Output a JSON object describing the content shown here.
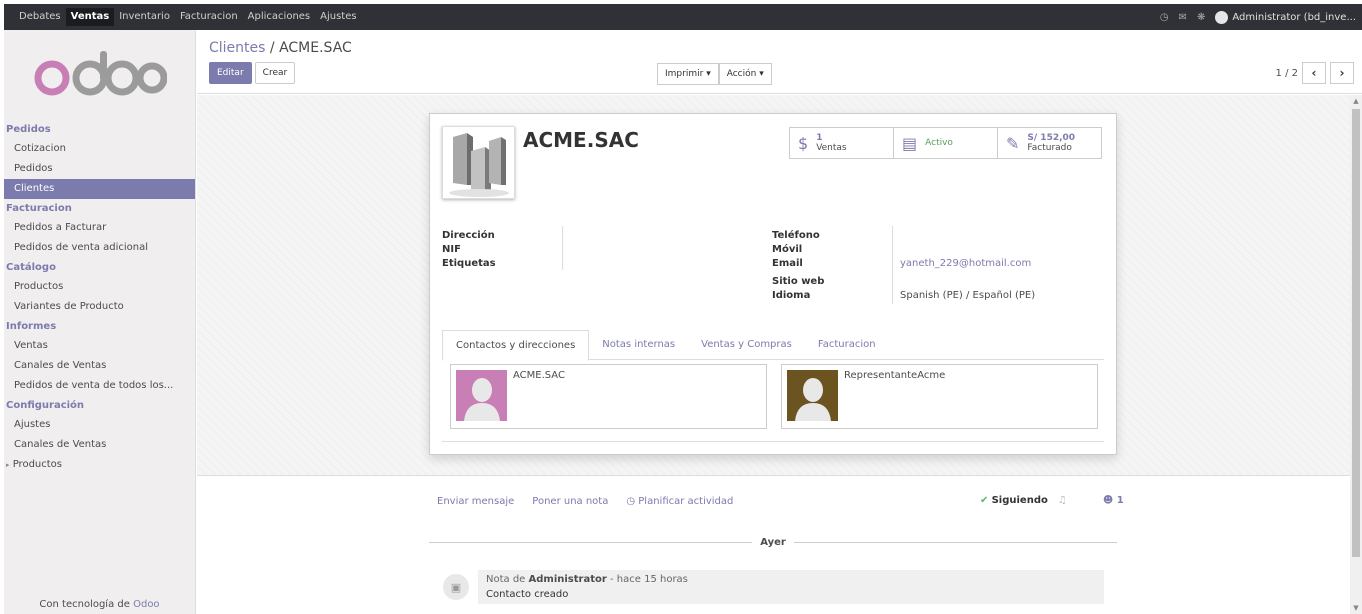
{
  "topbar": {
    "menu": [
      "Debates",
      "Ventas",
      "Inventario",
      "Facturacion",
      "Aplicaciones",
      "Ajustes"
    ],
    "active": "Ventas",
    "user": "Administrator (bd_inve..."
  },
  "sidebar": {
    "sections": [
      {
        "title": "Pedidos",
        "items": [
          "Cotizacion",
          "Pedidos",
          "Clientes"
        ]
      },
      {
        "title": "Facturacion",
        "items": [
          "Pedidos a Facturar",
          "Pedidos de venta adicional"
        ]
      },
      {
        "title": "Catálogo",
        "items": [
          "Productos",
          "Variantes de Producto"
        ]
      },
      {
        "title": "Informes",
        "items": [
          "Ventas",
          "Canales de Ventas",
          "Pedidos de venta de todos los..."
        ]
      },
      {
        "title": "Configuración",
        "items": [
          "Ajustes",
          "Canales de Ventas",
          "Productos"
        ]
      }
    ],
    "active_item": "Clientes",
    "footer_prefix": "Con tecnología de",
    "footer_brand": "Odoo",
    "logo_text": "odoo"
  },
  "control": {
    "breadcrumb_parent": "Clientes",
    "breadcrumb_sep": "/",
    "breadcrumb_current": "ACME.SAC",
    "edit_label": "Editar",
    "create_label": "Crear",
    "print_label": "Imprimir",
    "action_label": "Acción",
    "pager": "1 / 2"
  },
  "record": {
    "name": "ACME.SAC",
    "stats": [
      {
        "value": "1",
        "label": "Ventas"
      },
      {
        "value": "",
        "label": "Activo"
      },
      {
        "value": "S/ 152,00",
        "label": "Facturado"
      }
    ],
    "left_fields": [
      {
        "label": "Dirección",
        "value": ""
      },
      {
        "label": "NIF",
        "value": ""
      },
      {
        "label": "Etiquetas",
        "value": ""
      }
    ],
    "right_fields": {
      "telefono": "Teléfono",
      "movil": "Móvil",
      "email_label": "Email",
      "email": "yaneth_229@hotmail.com",
      "sitio_web": "Sitio web",
      "idioma_label": "Idioma",
      "idioma": "Spanish (PE) / Español (PE)"
    },
    "tabs": [
      "Contactos y direcciones",
      "Notas internas",
      "Ventas y Compras",
      "Facturacion"
    ],
    "contacts": [
      {
        "name": "ACME.SAC",
        "color": "#c77fb6"
      },
      {
        "name": "RepresentanteAcme",
        "color": "#6b5420"
      }
    ]
  },
  "chatter": {
    "send_message": "Enviar mensaje",
    "log_note": "Poner una nota",
    "schedule": "Planificar actividad",
    "following": "Siguiendo",
    "followers": "1",
    "separator": "Ayer",
    "msg_prefix": "Nota de",
    "msg_author": "Administrator",
    "msg_time": "- hace 15 horas",
    "msg_text": "Contacto creado"
  }
}
